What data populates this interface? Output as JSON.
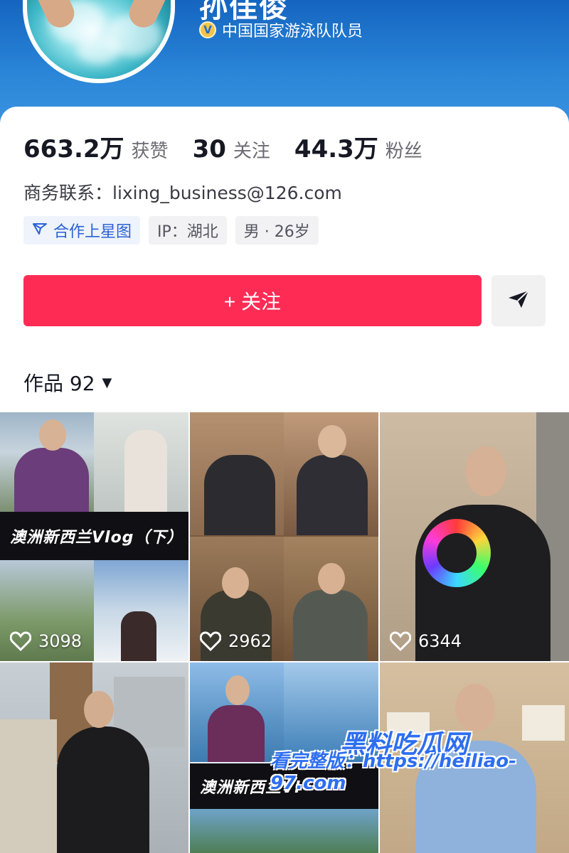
{
  "profile": {
    "name": "孙佳俊",
    "verification": "中国国家游泳队队员",
    "verified_badge": "V"
  },
  "stats": [
    {
      "value": "663.2万",
      "label": "获赞"
    },
    {
      "value": "30",
      "label": "关注"
    },
    {
      "value": "44.3万",
      "label": "粉丝"
    }
  ],
  "contact": "商务联系：lixing_business@126.com",
  "tags": [
    {
      "label": "合作上星图",
      "icon": "star-map-icon"
    },
    {
      "label": "IP：湖北"
    },
    {
      "label": "男 · 26岁"
    }
  ],
  "actions": {
    "follow_label": "+ 关注",
    "share_icon": "send-icon"
  },
  "works": {
    "label": "作品 92",
    "dropdown_icon": "▼"
  },
  "videos": [
    {
      "likes": "3098",
      "caption": "澳洲新西兰Vlog（下）"
    },
    {
      "likes": "2962"
    },
    {
      "likes": "6344"
    },
    {
      "likes": ""
    },
    {
      "likes": "",
      "caption": "澳洲新西兰Vl"
    },
    {
      "likes": ""
    }
  ],
  "watermark": {
    "line1": "黑料吃瓜网",
    "line2": "看完整版：https://heiliao-97.com"
  },
  "colors": {
    "accent": "#fe2c55",
    "banner": "#2a86d8",
    "verify_badge": "#f6c34a",
    "tag_blue": "#2a62d6"
  }
}
